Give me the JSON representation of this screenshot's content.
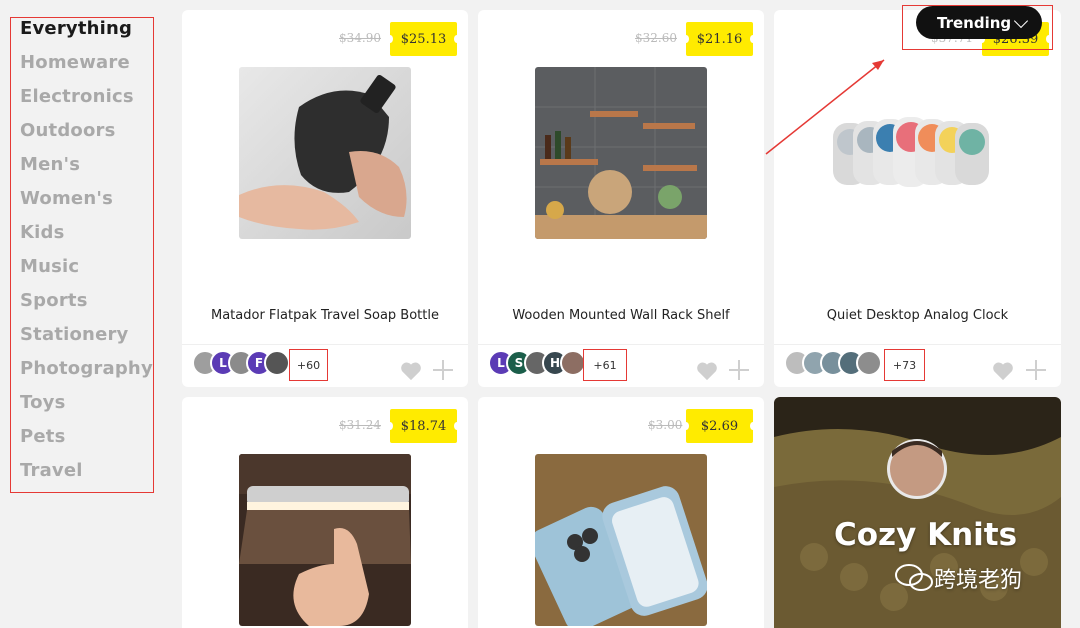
{
  "sidebar": {
    "categories": [
      "Everything",
      "Homeware",
      "Electronics",
      "Outdoors",
      "Men's",
      "Women's",
      "Kids",
      "Music",
      "Sports",
      "Stationery",
      "Photography",
      "Toys",
      "Pets",
      "Travel"
    ]
  },
  "sort": {
    "label": "Trending"
  },
  "products": [
    {
      "name": "Matador Flatpak Travel Soap Bottle",
      "price": "$25.13",
      "old_price": "$34.90",
      "saves": "+60"
    },
    {
      "name": "Wooden Mounted Wall Rack Shelf",
      "price": "$21.16",
      "old_price": "$32.60",
      "saves": "+61"
    },
    {
      "name": "Quiet Desktop Analog Clock",
      "price": "$26.39",
      "old_price": "$37.71",
      "saves": "+73"
    },
    {
      "name": "",
      "price": "$18.74",
      "old_price": "$31.24",
      "saves": ""
    },
    {
      "name": "",
      "price": "$2.69",
      "old_price": "$3.00",
      "saves": ""
    }
  ],
  "avatar_letters": {
    "p1": [
      "L",
      "F"
    ],
    "p2": [
      "L",
      "S",
      "H"
    ]
  },
  "collection": {
    "title": "Cozy Knits"
  },
  "watermark": {
    "text": "跨境老狗"
  },
  "colors": {
    "price_tag": "#ffeb00",
    "highlight_box": "#e53935",
    "active_category": "#1a1a1a",
    "inactive_category": "#a9a9a9"
  }
}
